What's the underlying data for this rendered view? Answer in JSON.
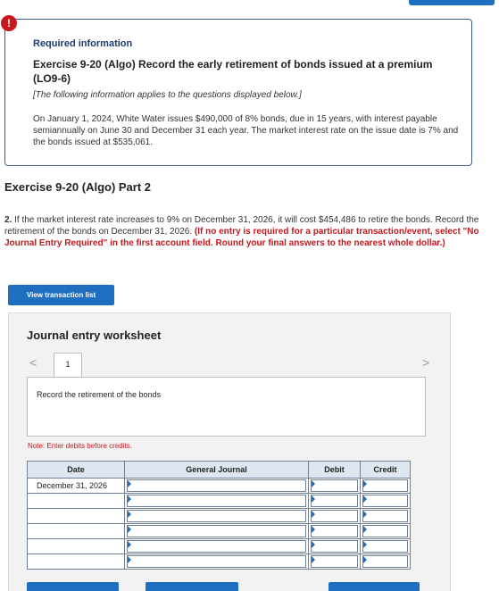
{
  "alert": {
    "icon": "!"
  },
  "info": {
    "heading": "Required information",
    "exercise_title": "Exercise 9-20 (Algo) Record the early retirement of bonds issued at a premium (LO9-6)",
    "applies_note": "[The following information applies to the questions displayed below.]",
    "description": "On January 1, 2024, White Water issues $490,000 of 8% bonds, due in 15 years, with interest payable semiannually on June 30 and December 31 each year. The market interest rate on the issue date is 7% and the bonds issued at $535,061."
  },
  "part_title": "Exercise 9-20 (Algo) Part 2",
  "question": {
    "number": "2.",
    "text": " If the market interest rate increases to 9% on December 31, 2026, it will cost $454,486 to retire the bonds. Record the retirement of the bonds on December 31, 2026. ",
    "instruction": "(If no entry is required for a particular transaction/event, select \"No Journal Entry Required\" in the first account field. Round your final answers to the nearest whole dollar.)"
  },
  "view_button": "View transaction list",
  "worksheet": {
    "title": "Journal entry worksheet",
    "nav_prev": "<",
    "nav_next": ">",
    "tab_label": "1",
    "tab_description": "Record the retirement of the bonds",
    "note": "Note: Enter debits before credits.",
    "columns": {
      "date": "Date",
      "journal": "General Journal",
      "debit": "Debit",
      "credit": "Credit"
    },
    "rows": [
      {
        "date": "December 31, 2026"
      },
      {
        "date": ""
      },
      {
        "date": ""
      },
      {
        "date": ""
      },
      {
        "date": ""
      },
      {
        "date": ""
      }
    ]
  }
}
